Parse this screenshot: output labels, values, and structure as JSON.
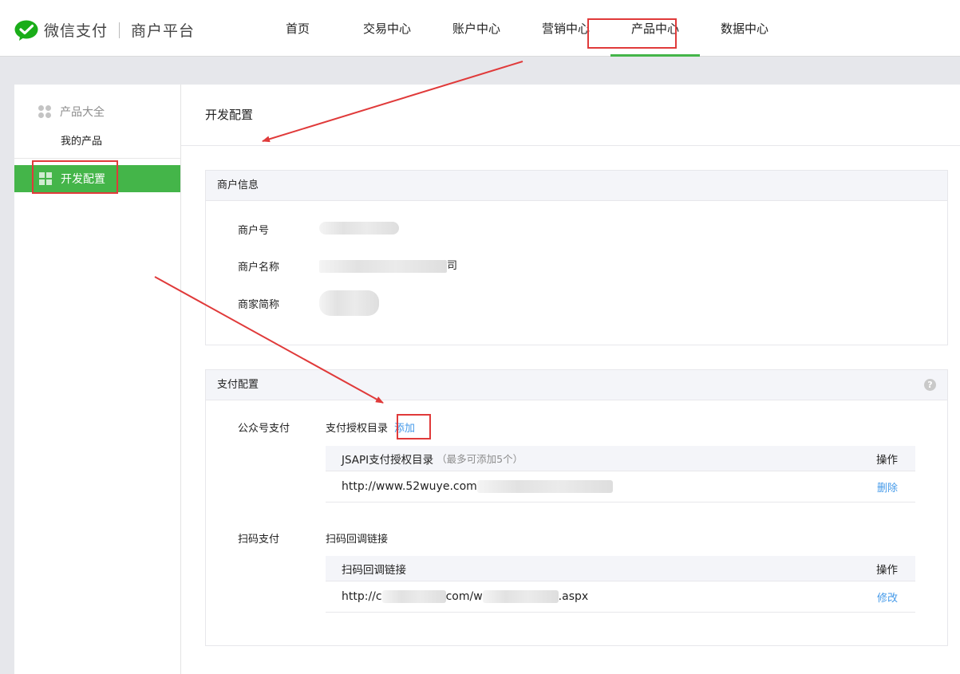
{
  "header": {
    "logo_text": "微信支付",
    "logo_sub": "商户平台",
    "nav": [
      "首页",
      "交易中心",
      "账户中心",
      "营销中心",
      "产品中心",
      "数据中心"
    ],
    "active_nav": "产品中心"
  },
  "sidebar": {
    "group_label": "产品大全",
    "sub_item": "我的产品",
    "active_item": "开发配置"
  },
  "main": {
    "title": "开发配置",
    "merchant": {
      "heading": "商户信息",
      "rows": [
        {
          "label": "商户号",
          "value": ""
        },
        {
          "label": "商户名称",
          "value": "司"
        },
        {
          "label": "商家简称",
          "value": ""
        }
      ]
    },
    "payment": {
      "heading": "支付配置",
      "help": "?",
      "jsapi": {
        "label": "公众号支付",
        "title": "支付授权目录",
        "add_link": "添加",
        "col_header": "JSAPI支付授权目录",
        "col_hint": "（最多可添加5个）",
        "op_header": "操作",
        "url": "http://www.52wuye.com",
        "action": "删除"
      },
      "scan": {
        "label": "扫码支付",
        "title": "扫码回调链接",
        "col_header": "扫码回调链接",
        "op_header": "操作",
        "url_parts": [
          "http://c",
          "com/w",
          ".aspx"
        ],
        "action": "修改"
      }
    }
  },
  "colors": {
    "brand_green": "#44b549",
    "link_blue": "#459ae9",
    "annotation_red": "#e03a3a"
  }
}
